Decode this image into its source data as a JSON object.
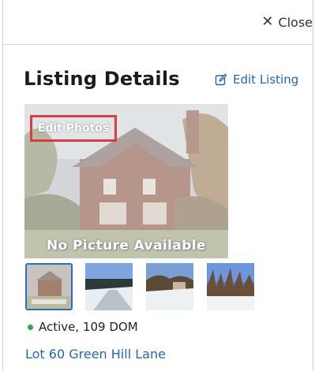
{
  "header": {
    "close_label": "Close"
  },
  "listing": {
    "title": "Listing Details",
    "edit_listing_label": "Edit Listing",
    "edit_photos_label": "Edit Photos",
    "no_picture_label": "No Picture Available",
    "status": "Active, 109 DOM",
    "status_color": "#2aa84a",
    "address_line1": "Lot 60 Green Hill Lane",
    "address_line2": ""
  },
  "thumbnails": [
    {
      "name": "thumb-house",
      "selected": true
    },
    {
      "name": "thumb-snow-road",
      "selected": false
    },
    {
      "name": "thumb-snow-yard",
      "selected": false
    },
    {
      "name": "thumb-snow-trees",
      "selected": false
    }
  ],
  "colors": {
    "link": "#1d67c0",
    "highlight": "#e03a43",
    "selected_border": "#2b6fc4"
  }
}
